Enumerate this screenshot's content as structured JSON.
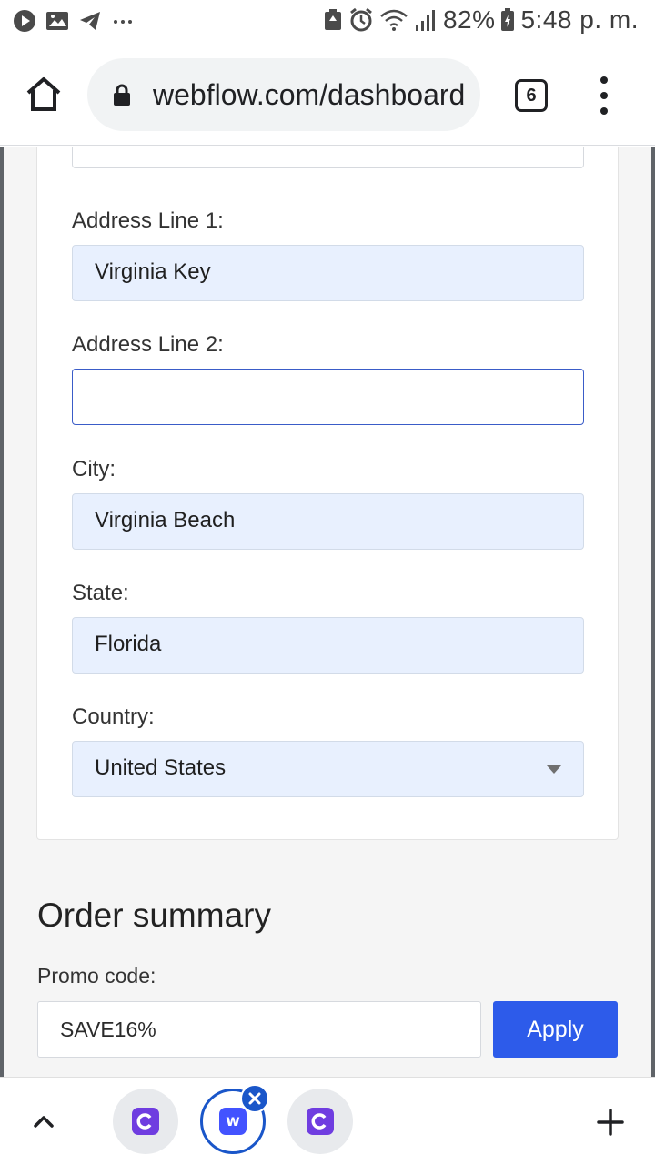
{
  "status_bar": {
    "battery": "82%",
    "time": "5:48 p. m.",
    "left_icons": [
      "play-icon",
      "image-icon",
      "telegram-icon",
      "more-dots-icon"
    ],
    "right_icons": [
      "battery-saver-icon",
      "alarm-icon",
      "wifi-icon",
      "signal-icon",
      "battery-icon"
    ]
  },
  "browser": {
    "url": "webflow.com/dashboard",
    "tab_count": "6"
  },
  "form": {
    "fields": [
      {
        "label": "Address Line 1:",
        "value": "Virginia Key"
      },
      {
        "label": "Address Line 2:",
        "value": ""
      },
      {
        "label": "City:",
        "value": "Virginia Beach"
      },
      {
        "label": "State:",
        "value": "Florida"
      },
      {
        "label": "Country:",
        "value": "United States"
      }
    ]
  },
  "order_summary": {
    "title": "Order summary",
    "promo_label": "Promo code:",
    "promo_value": "SAVE16%",
    "apply_label": "Apply"
  },
  "colors": {
    "accent": "#2d5bea",
    "autofill": "#e8f0fe",
    "focus_border": "#3a5cc8",
    "tab_active": "#1a56c9"
  },
  "bottom_bar": {
    "tab_icons": [
      "craft-icon",
      "webflow-icon",
      "craft-icon"
    ],
    "webflow_glyph": "w"
  }
}
